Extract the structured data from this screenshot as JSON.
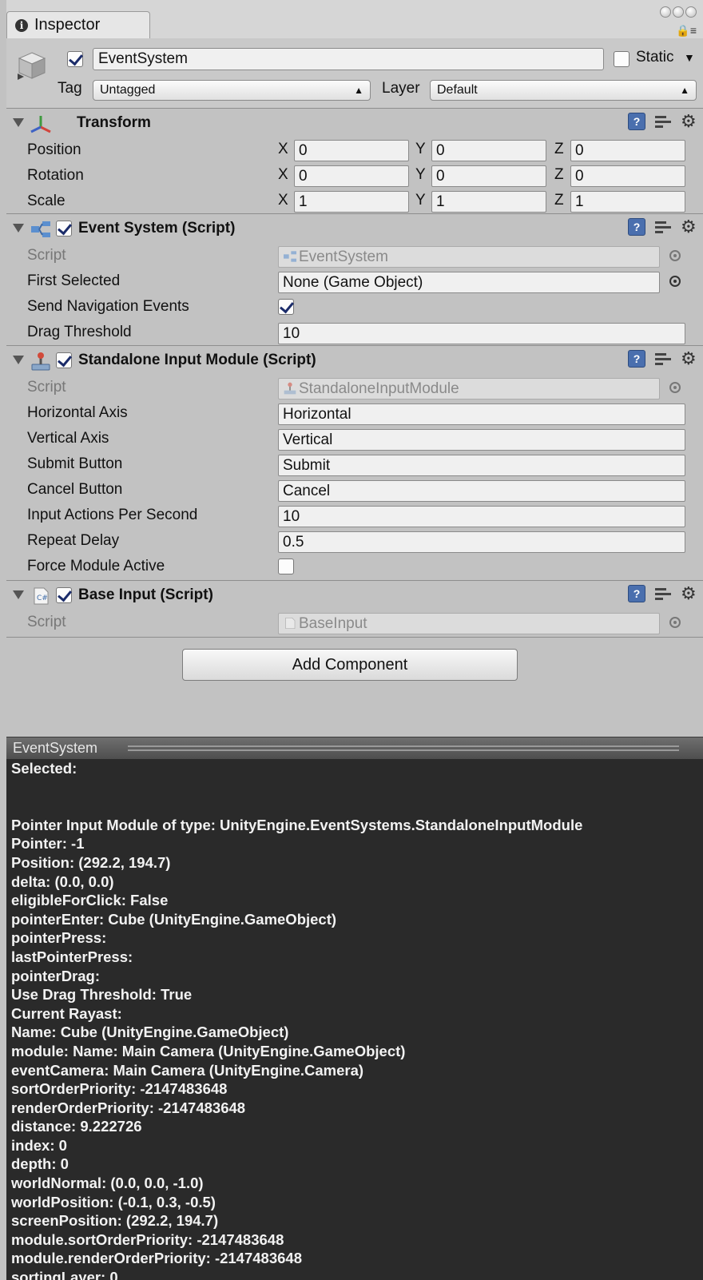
{
  "window": {
    "tab_title": "Inspector"
  },
  "gameobject": {
    "active": true,
    "name": "EventSystem",
    "static_label": "Static",
    "static": false,
    "tag_label": "Tag",
    "tag_value": "Untagged",
    "layer_label": "Layer",
    "layer_value": "Default"
  },
  "transform": {
    "title": "Transform",
    "axis_x": "X",
    "axis_y": "Y",
    "axis_z": "Z",
    "rows": [
      {
        "label": "Position",
        "x": "0",
        "y": "0",
        "z": "0"
      },
      {
        "label": "Rotation",
        "x": "0",
        "y": "0",
        "z": "0"
      },
      {
        "label": "Scale",
        "x": "1",
        "y": "1",
        "z": "1"
      }
    ]
  },
  "event_system": {
    "title": "Event System (Script)",
    "enabled": true,
    "script_label": "Script",
    "script_value": "EventSystem",
    "first_selected_label": "First Selected",
    "first_selected_value": "None (Game Object)",
    "send_nav_label": "Send Navigation Events",
    "send_nav_value": true,
    "drag_threshold_label": "Drag Threshold",
    "drag_threshold_value": "10"
  },
  "standalone_input": {
    "title": "Standalone Input Module (Script)",
    "enabled": true,
    "script_label": "Script",
    "script_value": "StandaloneInputModule",
    "rows": [
      {
        "label": "Horizontal Axis",
        "value": "Horizontal"
      },
      {
        "label": "Vertical Axis",
        "value": "Vertical"
      },
      {
        "label": "Submit Button",
        "value": "Submit"
      },
      {
        "label": "Cancel Button",
        "value": "Cancel"
      },
      {
        "label": "Input Actions Per Second",
        "value": "10"
      },
      {
        "label": "Repeat Delay",
        "value": "0.5"
      }
    ],
    "force_active_label": "Force Module Active",
    "force_active_value": false
  },
  "base_input": {
    "title": "Base Input (Script)",
    "enabled": true,
    "script_label": "Script",
    "script_value": "BaseInput"
  },
  "add_component_label": "Add Component",
  "preview": {
    "title": "EventSystem",
    "lines": [
      "Selected:",
      "",
      "",
      "Pointer Input Module of type: UnityEngine.EventSystems.StandaloneInputModule",
      "Pointer: -1",
      "Position: (292.2, 194.7)",
      "delta: (0.0, 0.0)",
      "eligibleForClick: False",
      "pointerEnter: Cube (UnityEngine.GameObject)",
      "pointerPress:",
      "lastPointerPress:",
      "pointerDrag:",
      "Use Drag Threshold: True",
      "Current Rayast:",
      "Name: Cube (UnityEngine.GameObject)",
      "module: Name: Main Camera (UnityEngine.GameObject)",
      "eventCamera: Main Camera (UnityEngine.Camera)",
      "sortOrderPriority: -2147483648",
      "renderOrderPriority: -2147483648",
      "distance: 9.222726",
      "index: 0",
      "depth: 0",
      "worldNormal: (0.0, 0.0, -1.0)",
      "worldPosition: (-0.1, 0.3, -0.5)",
      "screenPosition: (292.2, 194.7)",
      "module.sortOrderPriority: -2147483648",
      "module.renderOrderPriority: -2147483648",
      "sortingLayer: 0"
    ]
  }
}
